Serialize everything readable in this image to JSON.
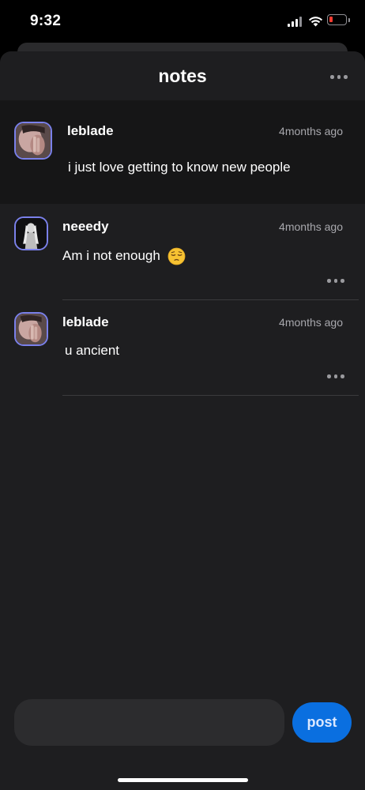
{
  "status_bar": {
    "time": "9:32",
    "battery_level": 0.1
  },
  "header": {
    "title": "notes",
    "menu_icon": "more-horizontal-icon"
  },
  "notes": [
    {
      "username": "leblade",
      "timestamp": "4months ago",
      "text": "i just love getting to know new people",
      "highlighted": true
    },
    {
      "username": "neeedy",
      "timestamp": "4months ago",
      "text": "Am i not enough",
      "emoji": "pensive-face-emoji"
    },
    {
      "username": "leblade",
      "timestamp": "4months ago",
      "text": "u ancient"
    }
  ],
  "composer": {
    "placeholder": "",
    "post_label": "post"
  },
  "colors": {
    "accent": "#0a6fe0",
    "avatar_border": "#7a80ea",
    "background": "#1e1e20",
    "highlight": "#161617"
  }
}
